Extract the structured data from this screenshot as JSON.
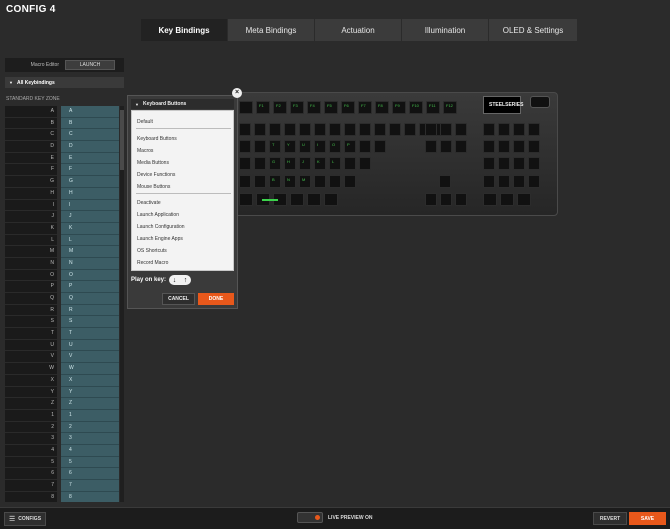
{
  "config_title": "CONFIG 4",
  "tabs": [
    {
      "label": "Key Bindings",
      "active": true
    },
    {
      "label": "Meta Bindings",
      "active": false
    },
    {
      "label": "Actuation",
      "active": false
    },
    {
      "label": "Illumination",
      "active": false
    },
    {
      "label": "OLED & Settings",
      "active": false
    }
  ],
  "left_panel": {
    "macro_editor_label": "Macro Editor",
    "launch_label": "LAUNCH",
    "all_keybindings_label": "All Keybindings",
    "zone_label": "STANDARD KEY ZONE",
    "rows": [
      {
        "key": "A",
        "binding": "A"
      },
      {
        "key": "B",
        "binding": "B"
      },
      {
        "key": "C",
        "binding": "C"
      },
      {
        "key": "D",
        "binding": "D"
      },
      {
        "key": "E",
        "binding": "E"
      },
      {
        "key": "F",
        "binding": "F"
      },
      {
        "key": "G",
        "binding": "G"
      },
      {
        "key": "H",
        "binding": "H"
      },
      {
        "key": "I",
        "binding": "I"
      },
      {
        "key": "J",
        "binding": "J"
      },
      {
        "key": "K",
        "binding": "K"
      },
      {
        "key": "L",
        "binding": "L"
      },
      {
        "key": "M",
        "binding": "M"
      },
      {
        "key": "N",
        "binding": "N"
      },
      {
        "key": "O",
        "binding": "O"
      },
      {
        "key": "P",
        "binding": "P"
      },
      {
        "key": "Q",
        "binding": "Q"
      },
      {
        "key": "R",
        "binding": "R"
      },
      {
        "key": "S",
        "binding": "S"
      },
      {
        "key": "T",
        "binding": "T"
      },
      {
        "key": "U",
        "binding": "U"
      },
      {
        "key": "V",
        "binding": "V"
      },
      {
        "key": "W",
        "binding": "W"
      },
      {
        "key": "X",
        "binding": "X"
      },
      {
        "key": "Y",
        "binding": "Y"
      },
      {
        "key": "Z",
        "binding": "Z"
      },
      {
        "key": "1",
        "binding": "1"
      },
      {
        "key": "2",
        "binding": "2"
      },
      {
        "key": "3",
        "binding": "3"
      },
      {
        "key": "4",
        "binding": "4"
      },
      {
        "key": "5",
        "binding": "5"
      },
      {
        "key": "6",
        "binding": "6"
      },
      {
        "key": "7",
        "binding": "7"
      },
      {
        "key": "8",
        "binding": "8"
      }
    ]
  },
  "keyboard": {
    "oled_logo": "STEELSERIES",
    "row_labels": {
      "row1": [
        "",
        "F1",
        "F2",
        "F3",
        "F4",
        "F5",
        "F6",
        "F7",
        "F8",
        "F9",
        "F10",
        "F11",
        "F12"
      ],
      "row3": [
        "",
        "",
        "T",
        "Y",
        "U",
        "I",
        "O",
        "P",
        "",
        ""
      ],
      "row4": [
        "",
        "",
        "G",
        "H",
        "J",
        "K",
        "L",
        "",
        ""
      ],
      "row5": [
        "",
        "",
        "B",
        "N",
        "M",
        "",
        "",
        ""
      ]
    },
    "key_color": "#44c24c"
  },
  "dialog": {
    "header_label": "Keyboard Buttons",
    "items_group1": [
      "Default"
    ],
    "items_group2": [
      "Keyboard Buttons",
      "Macros",
      "Media Buttons",
      "Device Functions",
      "Mouse Buttons"
    ],
    "items_group3": [
      "Deactivate",
      "Launch Application",
      "Launch Configuration",
      "Launch Engine Apps",
      "OS Shortcuts",
      "Record Macro"
    ],
    "play_on_key_label": "Play on key:",
    "play_icons": [
      "↓",
      "↑"
    ],
    "cancel_label": "CANCEL",
    "done_label": "DONE",
    "close_glyph": "×"
  },
  "bottom_bar": {
    "configs_label": "CONFIGS",
    "live_preview_label": "LIVE PREVIEW ON",
    "revert_label": "REVERT",
    "save_label": "SAVE"
  },
  "colors": {
    "accent": "#e8581b",
    "binding_bg": "#3c5d65"
  }
}
